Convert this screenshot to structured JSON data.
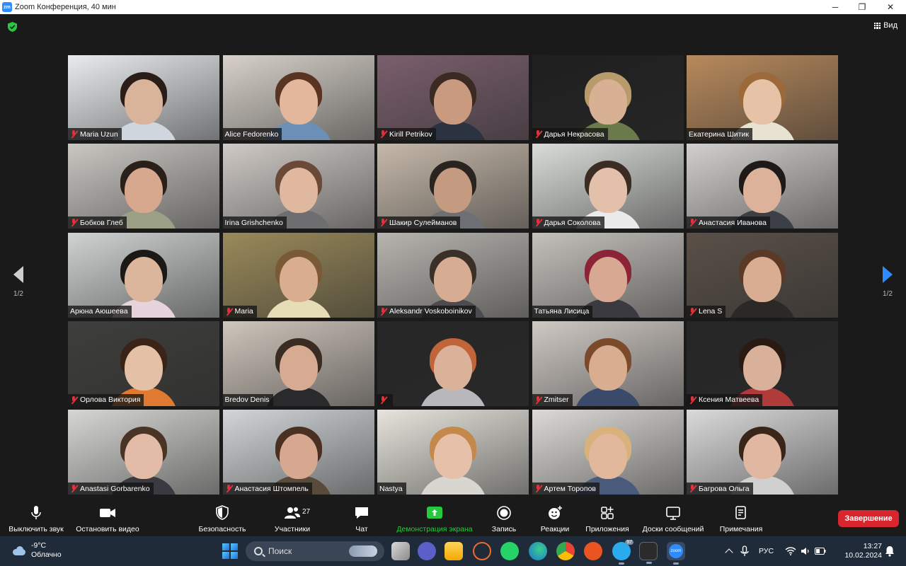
{
  "window": {
    "title": "Zoom Конференция, 40 мин",
    "logo_text": "zm",
    "minimize": "─",
    "maximize": "❐",
    "close": "✕"
  },
  "meeting": {
    "view_label": "Вид",
    "page_left": "1/2",
    "page_right": "1/2",
    "participants": [
      {
        "name": "Maria Uzun",
        "muted": true,
        "bg": "#e9ecef",
        "skin": "#d9b39a",
        "hair": "#2a1d18",
        "shirt": "#cfd6dd"
      },
      {
        "name": "Alice Fedorenko",
        "muted": false,
        "bg": "#d7d1c9",
        "skin": "#e2b79c",
        "hair": "#5a3422",
        "shirt": "#6c8fb5"
      },
      {
        "name": "Kirill Petrikov",
        "muted": true,
        "bg": "#7a5f6c",
        "skin": "#c99a80",
        "hair": "#3a2a22",
        "shirt": "#2c3340"
      },
      {
        "name": "Дарья Некрасова",
        "muted": true,
        "bg": "#1f1f1f",
        "skin": "#d8b094",
        "hair": "#b99a6a",
        "shirt": "#6a7a4a"
      },
      {
        "name": "Екатерина Шитик",
        "muted": false,
        "bg": "#b88a5c",
        "skin": "#e6c2a6",
        "hair": "#9c6a3a",
        "shirt": "#e8e2d2",
        "active": true
      },
      {
        "name": "Бобков Глеб",
        "muted": true,
        "bg": "#c9c7c2",
        "skin": "#d8a88e",
        "hair": "#2b1f1a",
        "shirt": "#9a9f86"
      },
      {
        "name": "Irina Grishchenko",
        "muted": false,
        "bg": "#cfcac6",
        "skin": "#e0b8a0",
        "hair": "#6a4a36",
        "shirt": "#6e6e70"
      },
      {
        "name": "Шакир Сулейманов",
        "muted": true,
        "bg": "#c6b9aa",
        "skin": "#c49a80",
        "hair": "#2a2420",
        "shirt": "#6d6f74"
      },
      {
        "name": "Дарья Соколова",
        "muted": true,
        "bg": "#d9dcd8",
        "skin": "#e2c0aa",
        "hair": "#3b2c24",
        "shirt": "#eaeaea"
      },
      {
        "name": "Анастасия Иванова",
        "muted": true,
        "bg": "#d2d0cd",
        "skin": "#dcb29a",
        "hair": "#1e1a18",
        "shirt": "#3c3f46"
      },
      {
        "name": "Арюна Аюшеева",
        "muted": false,
        "bg": "#cfd3d2",
        "skin": "#dcb69c",
        "hair": "#1c1816",
        "shirt": "#e6d3dc"
      },
      {
        "name": "Maria",
        "muted": true,
        "bg": "#9a8a5a",
        "skin": "#d9ae8e",
        "hair": "#7a5a36",
        "shirt": "#e6dcb6"
      },
      {
        "name": "Aleksandr Voskoboinikov",
        "muted": true,
        "bg": "#b8b5b0",
        "skin": "#d6ad92",
        "hair": "#3a3028",
        "shirt": "#4c4c50"
      },
      {
        "name": "Татьяна Лисица",
        "muted": false,
        "bg": "#c4c1bc",
        "skin": "#d7a892",
        "hair": "#8a2436",
        "shirt": "#3a3a40"
      },
      {
        "name": "Lena S",
        "muted": true,
        "bg": "#5a5048",
        "skin": "#d8ad92",
        "hair": "#5a3a26",
        "shirt": "#2c2826"
      },
      {
        "name": "Орлова Виктория",
        "muted": true,
        "bg": "#3e3e3c",
        "skin": "#e4c0a6",
        "hair": "#3a2418",
        "shirt": "#e07a30"
      },
      {
        "name": "Bredov Denis",
        "muted": false,
        "bg": "#cfc6bc",
        "skin": "#d7ab92",
        "hair": "#3a2c22",
        "shirt": "#2a2a2c"
      },
      {
        "name": "",
        "muted": true,
        "bg": "#262626",
        "skin": "#dab29a",
        "hair": "#c0643a",
        "shirt": "#b8b8bc"
      },
      {
        "name": "Zmitser",
        "muted": true,
        "bg": "#cfc9c4",
        "skin": "#d8ad90",
        "hair": "#7a4a2a",
        "shirt": "#3a4a6a"
      },
      {
        "name": "Ксения Матвеева",
        "muted": true,
        "bg": "#262626",
        "skin": "#d9b09a",
        "hair": "#2a1a14",
        "shirt": "#b13a3a"
      },
      {
        "name": "Anastasi Gorbarenko",
        "muted": true,
        "bg": "#d6d6d4",
        "skin": "#e2bca6",
        "hair": "#4a3426",
        "shirt": "#3a3a40"
      },
      {
        "name": "Анастасия Штомпель",
        "muted": true,
        "bg": "#d2d6d8",
        "skin": "#d6a890",
        "hair": "#4a3020",
        "shirt": "#5a4a3a"
      },
      {
        "name": "Nastya",
        "muted": false,
        "bg": "#e6e4dc",
        "skin": "#e6c0a8",
        "hair": "#c4884a",
        "shirt": "#d8d6d0"
      },
      {
        "name": "Артем Торопов",
        "muted": true,
        "bg": "#dcdad6",
        "skin": "#e2b89c",
        "hair": "#d8b27a",
        "shirt": "#4a5a7a"
      },
      {
        "name": "Багрова Ольга",
        "muted": true,
        "bg": "#dadada",
        "skin": "#e0b8a2",
        "hair": "#3a2618",
        "shirt": "#d0d0d0"
      }
    ]
  },
  "controls": {
    "mute": "Выключить звук",
    "stop_video": "Остановить видео",
    "security": "Безопасность",
    "participants": "Участники",
    "participants_count": "27",
    "chat": "Чат",
    "share_screen": "Демонстрация экрана",
    "record": "Запись",
    "reactions": "Реакции",
    "apps": "Приложения",
    "whiteboards": "Доски сообщений",
    "notes": "Примечания",
    "end": "Завершение"
  },
  "taskbar": {
    "temperature": "-9°C",
    "weather": "Облачно",
    "search_placeholder": "Поиск",
    "language": "РУС",
    "time": "13:27",
    "date": "10.02.2024",
    "telegram_badge": "97",
    "zoom_label": "zoom"
  },
  "colors": {
    "accent_blue": "#2d8cff",
    "share_green": "#27c93f",
    "end_red": "#d9262e",
    "active_outline": "#d6e36a",
    "muted_red": "#e0313b"
  }
}
